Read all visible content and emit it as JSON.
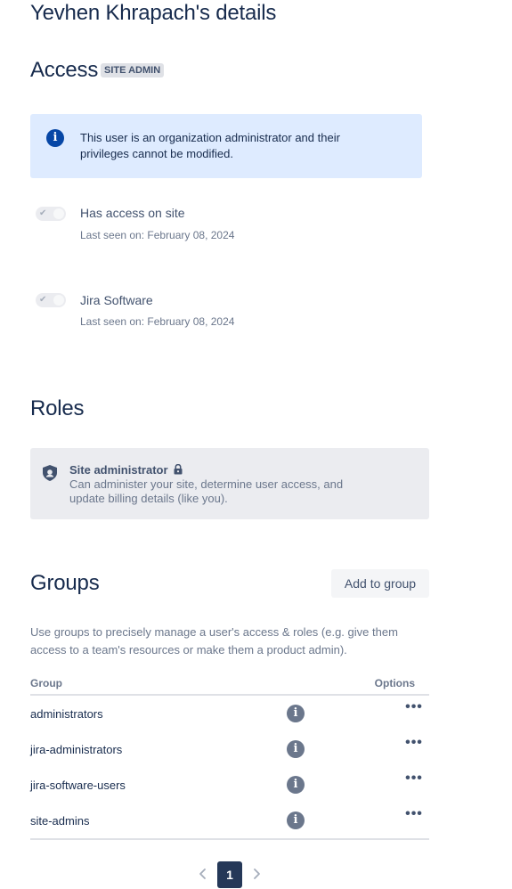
{
  "page": {
    "title": "Yevhen Khrapach's details"
  },
  "access": {
    "title": "Access",
    "badge": "SITE ADMIN",
    "info_message": "This user is an organization administrator and their privileges cannot be modified.",
    "items": [
      {
        "label": "Has access on site",
        "last_seen": "Last seen on: February 08, 2024",
        "enabled": true
      },
      {
        "label": "Jira Software",
        "last_seen": "Last seen on: February 08, 2024",
        "enabled": true
      }
    ]
  },
  "roles": {
    "title": "Roles",
    "role_title": "Site administrator",
    "role_desc": "Can administer your site, determine user access, and update billing details (like you)."
  },
  "groups": {
    "title": "Groups",
    "add_button": "Add to group",
    "description": "Use groups to precisely manage a user's access & roles (e.g. give them access to a team's resources or make them a product admin).",
    "col_group": "Group",
    "col_options": "Options",
    "rows": [
      {
        "name": "administrators"
      },
      {
        "name": "jira-administrators"
      },
      {
        "name": "jira-software-users"
      },
      {
        "name": "site-admins"
      }
    ]
  },
  "pagination": {
    "current_page": "1"
  },
  "colors": {
    "info_bg": "#deebff",
    "info_icon": "#0747a6",
    "role_bg": "#ebecf0",
    "pager_active": "#253858"
  },
  "icons": {
    "info": "info-icon",
    "shield": "shield-icon",
    "lock": "lock-icon",
    "more": "more-icon",
    "prev": "chevron-left-icon",
    "next": "chevron-right-icon"
  }
}
